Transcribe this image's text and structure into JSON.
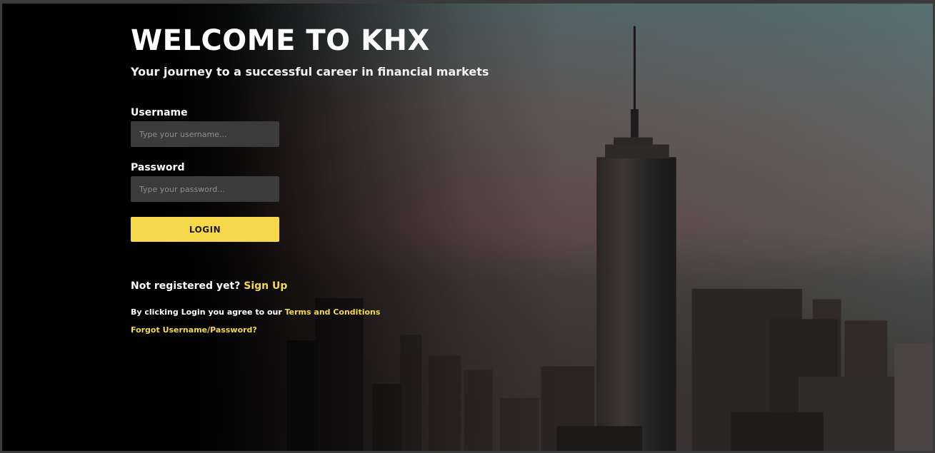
{
  "header": {
    "title": "WELCOME TO KHX",
    "subtitle": "Your journey to a successful career in financial markets"
  },
  "form": {
    "username_label": "Username",
    "username_placeholder": "Type your username...",
    "password_label": "Password",
    "password_placeholder": "Type your password...",
    "login_label": "LOGIN"
  },
  "register": {
    "prompt": "Not registered yet?",
    "link": "Sign Up"
  },
  "terms": {
    "text": "By clicking Login you agree to our",
    "link": "Terms and Conditions"
  },
  "forgot": {
    "link": "Forgot Username/Password?"
  },
  "colors": {
    "accent": "#f5d94a",
    "background": "#000000",
    "input_bg": "#3b3b3b"
  }
}
